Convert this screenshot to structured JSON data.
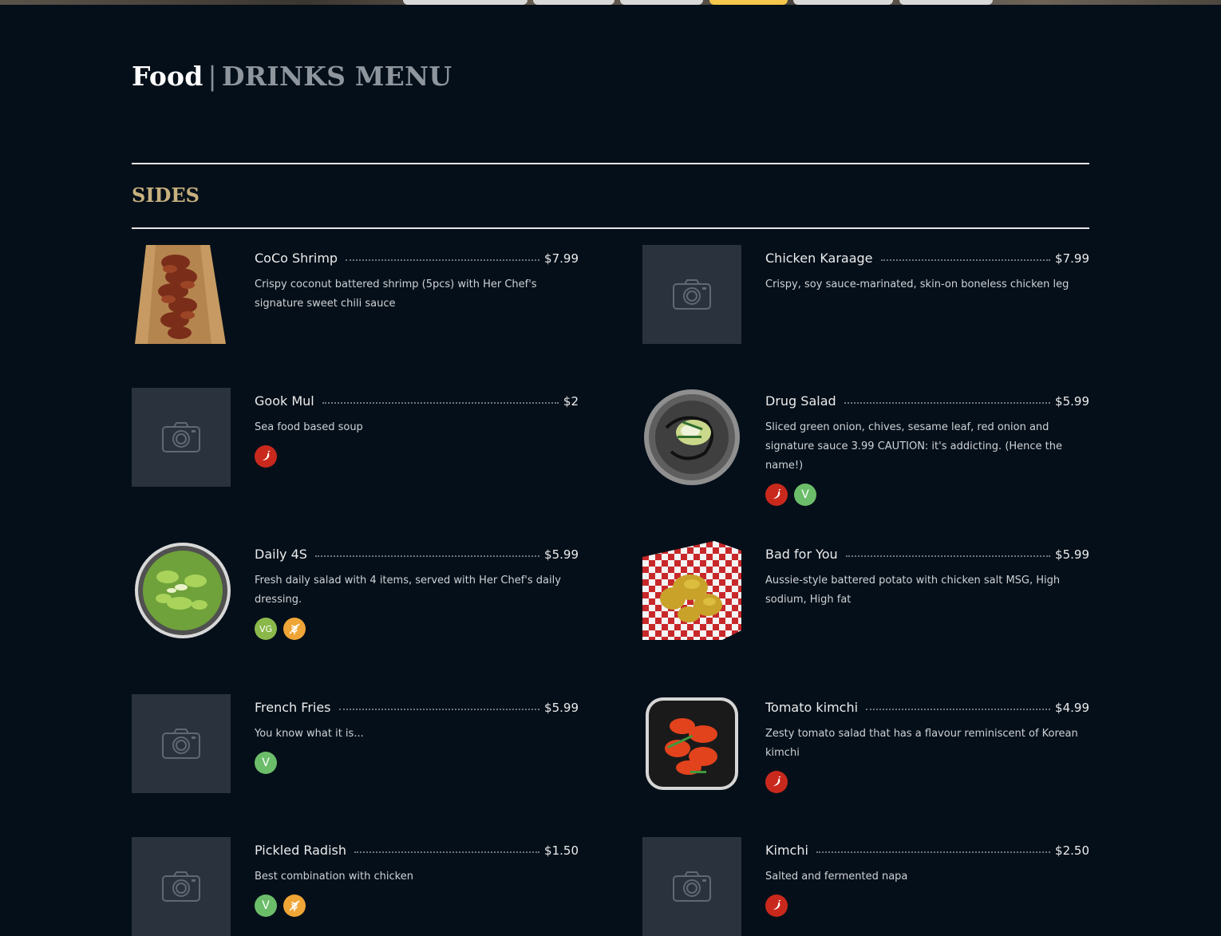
{
  "header": {
    "food_label": "Food",
    "separator": "|",
    "drinks_label": "DRINKS MENU"
  },
  "section": {
    "title": "SIDES"
  },
  "colors": {
    "background": "#040f19",
    "accent_gold": "#c7b07e",
    "spicy": "#c9291d",
    "vegetarian": "#6cbd6a",
    "vegan": "#8ab84a",
    "gluten_free": "#f0a537",
    "active_tab": "#f5c84b"
  },
  "items": [
    {
      "name": "CoCo Shrimp",
      "price": "$7.99",
      "description": "Crispy coconut battered shrimp (5pcs) with Her Chef's signature sweet chili sauce",
      "image": "photo-shrimp",
      "badges": []
    },
    {
      "name": "Chicken Karaage",
      "price": "$7.99",
      "description": "Crispy, soy sauce-marinated, skin-on boneless chicken leg",
      "image": "placeholder-camera",
      "badges": []
    },
    {
      "name": "Gook Mul",
      "price": "$2",
      "description": "Sea food based soup",
      "image": "placeholder-camera",
      "badges": [
        "spicy"
      ]
    },
    {
      "name": "Drug Salad",
      "price": "$5.99",
      "description": "Sliced green onion, chives, sesame leaf, red onion and signature sauce 3.99 CAUTION: it's addicting. (Hence the name!)",
      "image": "photo-salad-plate",
      "badges": [
        "spicy",
        "V"
      ]
    },
    {
      "name": "Daily 4S",
      "price": "$5.99",
      "description": "Fresh daily salad with 4 items, served with Her Chef's daily dressing.",
      "image": "photo-green-salad",
      "badges": [
        "VG",
        "gluten-free"
      ]
    },
    {
      "name": "Bad for You",
      "price": "$5.99",
      "description": "Aussie-style battered potato with chicken salt MSG, High sodium, High fat",
      "image": "photo-battered-potato",
      "badges": []
    },
    {
      "name": "French Fries",
      "price": "$5.99",
      "description": "You know what it is...",
      "image": "placeholder-camera",
      "badges": [
        "V"
      ]
    },
    {
      "name": "Tomato kimchi",
      "price": "$4.99",
      "description": "Zesty tomato salad that has a flavour reminiscent of Korean kimchi",
      "image": "photo-tomato-kimchi",
      "badges": [
        "spicy"
      ]
    },
    {
      "name": "Pickled Radish",
      "price": "$1.50",
      "description": "Best combination with chicken",
      "image": "placeholder-camera",
      "badges": [
        "V",
        "gluten-free"
      ]
    },
    {
      "name": "Kimchi",
      "price": "$2.50",
      "description": "Salted and fermented napa",
      "image": "placeholder-camera",
      "badges": [
        "spicy"
      ]
    }
  ]
}
